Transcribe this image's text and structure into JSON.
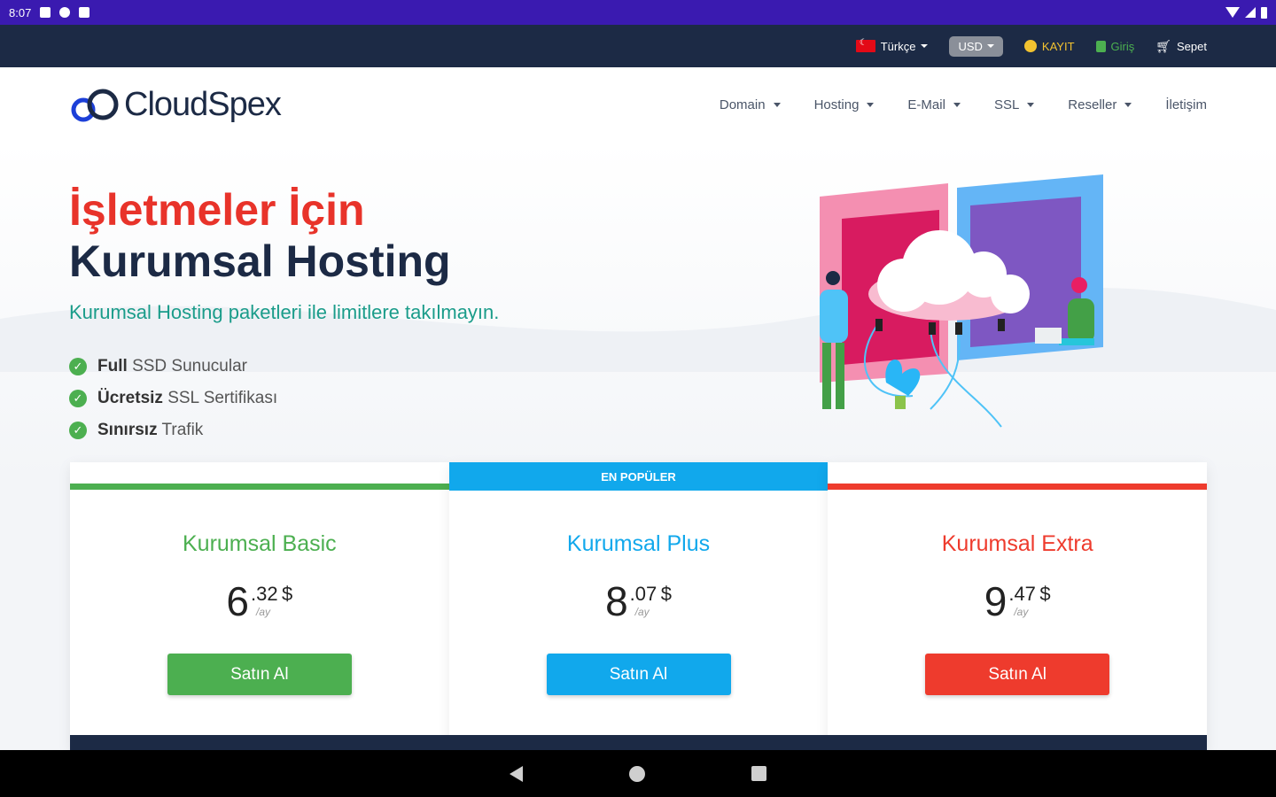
{
  "status_bar": {
    "time": "8:07"
  },
  "topbar": {
    "language": "Türkçe",
    "currency": "USD",
    "register": "KAYIT",
    "login": "Giriş",
    "cart": "Sepet"
  },
  "header": {
    "logo": "CloudSpex",
    "nav": [
      {
        "label": "Domain",
        "dropdown": true
      },
      {
        "label": "Hosting",
        "dropdown": true
      },
      {
        "label": "E-Mail",
        "dropdown": true
      },
      {
        "label": "SSL",
        "dropdown": true
      },
      {
        "label": "Reseller",
        "dropdown": true
      },
      {
        "label": "İletişim",
        "dropdown": false
      }
    ]
  },
  "hero": {
    "title_line1": "İşletmeler İçin",
    "title_line2": "Kurumsal Hosting",
    "subtitle": "Kurumsal Hosting paketleri ile limitlere takılmayın.",
    "features": [
      {
        "bold": "Full",
        "text": "SSD Sunucular"
      },
      {
        "bold": "Ücretsiz",
        "text": "SSL Sertifikası"
      },
      {
        "bold": "Sınırsız",
        "text": "Trafik"
      }
    ]
  },
  "plans": [
    {
      "name": "Kurumsal Basic",
      "whole": "6",
      "cents": ".32",
      "currency": "$",
      "period": "/ay",
      "button": "Satın Al",
      "color": "#4caf50",
      "badge": ""
    },
    {
      "name": "Kurumsal Plus",
      "whole": "8",
      "cents": ".07",
      "currency": "$",
      "period": "/ay",
      "button": "Satın Al",
      "color": "#11a8ec",
      "badge": "EN POPÜLER"
    },
    {
      "name": "Kurumsal Extra",
      "whole": "9",
      "cents": ".47",
      "currency": "$",
      "period": "/ay",
      "button": "Satın Al",
      "color": "#ee3b2d",
      "badge": ""
    }
  ],
  "colors": {
    "navy": "#1c2a45",
    "statusbar": "#3a1ab0",
    "accent_red": "#e8332a",
    "accent_teal": "#1a9c8a"
  }
}
